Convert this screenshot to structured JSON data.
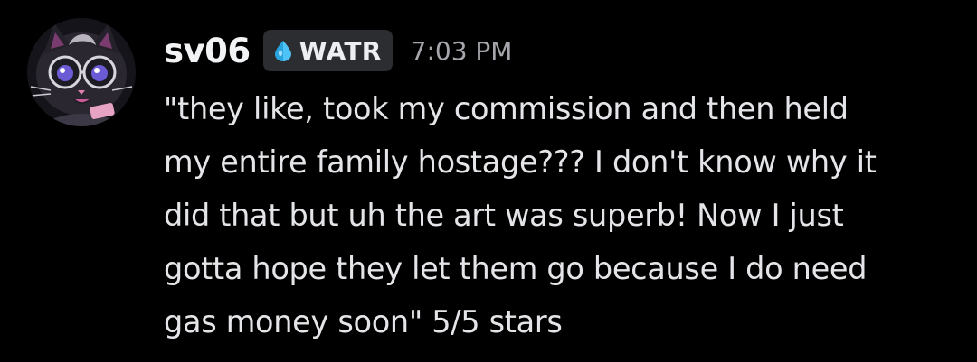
{
  "message": {
    "author": {
      "username": "sv06",
      "avatar_icon": "cat-avatar-icon",
      "tag": {
        "icon": "water-drop-icon",
        "label": "WATR",
        "icon_color": "#4fc3f7"
      }
    },
    "timestamp": "7:03 PM",
    "content_lines": [
      "\"they like, took my commission and then held",
      "my entire family hostage??? I don't know why it",
      "did that but uh the art was superb! Now I just",
      "gotta hope they let them go because I do need",
      "gas money soon\" 5/5 stars"
    ]
  },
  "colors": {
    "background": "#000000",
    "username": "#f2f3f5",
    "text": "#e4e5e8",
    "timestamp": "#a4a6ab",
    "tag_background": "#2b2d31"
  }
}
